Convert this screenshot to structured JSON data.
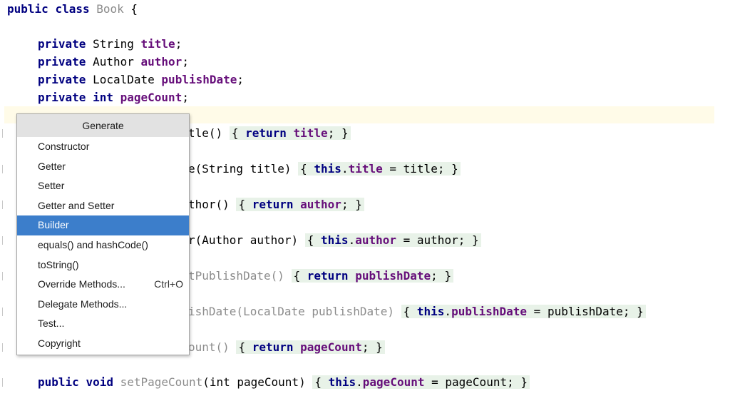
{
  "code": {
    "kw_public": "public",
    "kw_class": "class",
    "kw_private": "private",
    "kw_return": "return",
    "kw_this": "this",
    "kw_void": "void",
    "kw_int": "int",
    "class_name": "Book",
    "type_string": "String",
    "type_author": "Author",
    "type_localdate": "LocalDate",
    "field_title": "title",
    "field_author": "author",
    "field_publishDate": "publishDate",
    "field_pageCount": "pageCount",
    "frag_title_get": "tle()",
    "frag_title_set": "e(String title)",
    "frag_author_get": "thor()",
    "frag_author_set": "r(Author author)",
    "frag_publish_get": "tPublishDate()",
    "frag_publish_set": "ishDate(LocalDate publishDate)",
    "frag_pagecount_get": "ount()",
    "method_setPageCount": "setPageCount",
    "param_pagecount": "(int pageCount)",
    "assign_title": "= title;",
    "assign_author": "= author;",
    "assign_publish": "= publishDate;",
    "assign_pagecount": "= pageCount;"
  },
  "popup": {
    "title": "Generate",
    "items": [
      {
        "label": "Constructor"
      },
      {
        "label": "Getter"
      },
      {
        "label": "Setter"
      },
      {
        "label": "Getter and Setter"
      },
      {
        "label": "Builder",
        "selected": true
      },
      {
        "label": "equals() and hashCode()"
      },
      {
        "label": "toString()"
      },
      {
        "label": "Override Methods...",
        "shortcut": "Ctrl+O"
      },
      {
        "label": "Delegate Methods..."
      },
      {
        "label": "Test..."
      },
      {
        "label": "Copyright"
      }
    ]
  }
}
